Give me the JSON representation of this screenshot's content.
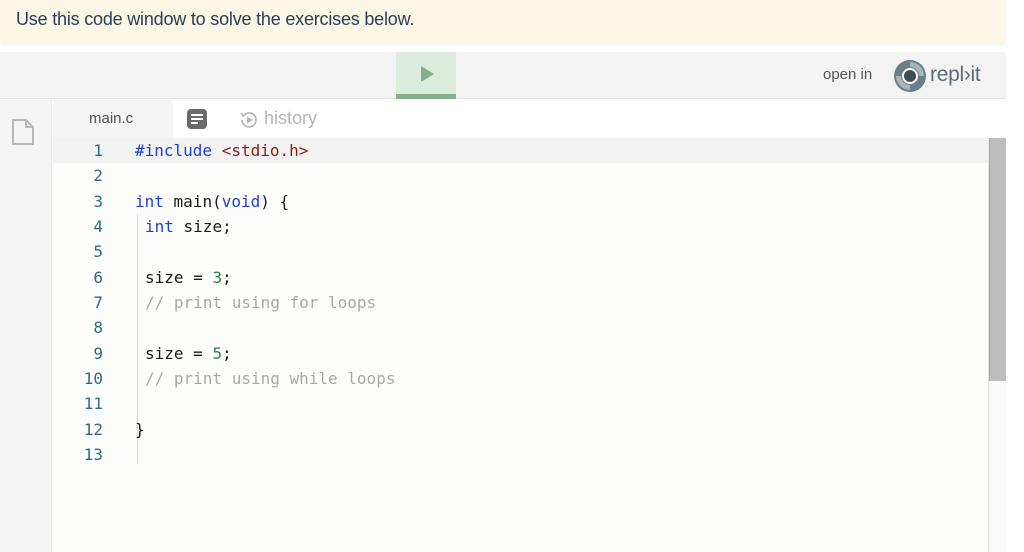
{
  "banner": {
    "text": "Use this code window to solve the exercises below."
  },
  "toolbar": {
    "run_icon": "play-icon",
    "open_in_label": "open in",
    "brand_name": "repl›it",
    "colors": {
      "run_bg": "#dcecdc",
      "run_bar": "#83b08a",
      "run_icon": "#83b08a"
    }
  },
  "sidebar": {
    "icon": "file-icon"
  },
  "tabs": {
    "file_tab": "main.c",
    "console_icon": "console-icon",
    "history_label": "history"
  },
  "editor": {
    "active_line": 1,
    "lines": [
      {
        "n": "1",
        "text": "#include <stdio.h>"
      },
      {
        "n": "2",
        "text": ""
      },
      {
        "n": "3",
        "text": "int main(void) {"
      },
      {
        "n": "4",
        "text": " int size;"
      },
      {
        "n": "5",
        "text": ""
      },
      {
        "n": "6",
        "text": " size = 3;"
      },
      {
        "n": "7",
        "text": " // print using for loops"
      },
      {
        "n": "8",
        "text": ""
      },
      {
        "n": "9",
        "text": " size = 5;"
      },
      {
        "n": "10",
        "text": " // print using while loops"
      },
      {
        "n": "11",
        "text": ""
      },
      {
        "n": "12",
        "text": "}"
      },
      {
        "n": "13",
        "text": ""
      }
    ],
    "tokens": {
      "l1_directive": "#include",
      "l1_header": "<stdio.h>",
      "l3_int": "int",
      "l3_main": " main(",
      "l3_void": "void",
      "l3_rest": ") {",
      "l4_int": "int",
      "l4_rest": " size;",
      "l6_pre": "size = ",
      "l6_num": "3",
      "l6_post": ";",
      "l7_cmt": "// print using for loops",
      "l9_pre": "size = ",
      "l9_num": "5",
      "l9_post": ";",
      "l10_cmt": "// print using while loops",
      "l12_brace": "}"
    }
  }
}
